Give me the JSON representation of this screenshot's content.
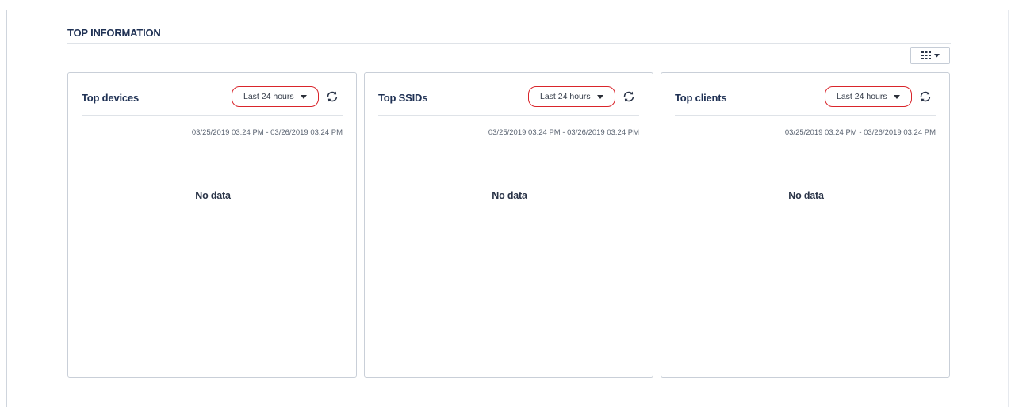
{
  "section": {
    "title": "TOP INFORMATION",
    "column_picker_icon": "grid-icon"
  },
  "accent_color": "#d9252b",
  "cards": [
    {
      "title": "Top devices",
      "range_label": "Last 24 hours",
      "date_range": "03/25/2019 03:24 PM - 03/26/2019 03:24 PM",
      "empty_text": "No data"
    },
    {
      "title": "Top SSIDs",
      "range_label": "Last 24 hours",
      "date_range": "03/25/2019 03:24 PM - 03/26/2019 03:24 PM",
      "empty_text": "No data"
    },
    {
      "title": "Top clients",
      "range_label": "Last 24 hours",
      "date_range": "03/25/2019 03:24 PM - 03/26/2019 03:24 PM",
      "empty_text": "No data"
    }
  ]
}
